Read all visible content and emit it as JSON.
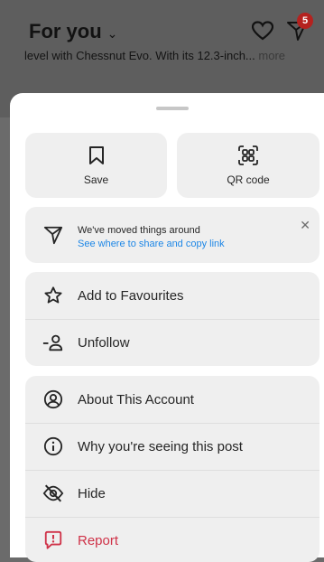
{
  "feed": {
    "title": "For you",
    "badge_count": "5",
    "caption_text": "level with Chessnut Evo. With its 12.3-inch...",
    "caption_more": "more"
  },
  "sheet": {
    "tiles": [
      {
        "label": "Save",
        "icon": "bookmark-icon"
      },
      {
        "label": "QR code",
        "icon": "qr-code-icon"
      }
    ],
    "notice": {
      "title": "We've moved things around",
      "link": "See where to share and copy link",
      "icon": "send-icon"
    },
    "group_a": [
      {
        "label": "Add to Favourites",
        "icon": "star-icon"
      },
      {
        "label": "Unfollow",
        "icon": "unfollow-icon"
      }
    ],
    "group_b": [
      {
        "label": "About This Account",
        "icon": "account-icon"
      },
      {
        "label": "Why you're seeing this post",
        "icon": "info-icon"
      },
      {
        "label": "Hide",
        "icon": "hide-icon"
      },
      {
        "label": "Report",
        "icon": "report-icon"
      }
    ]
  },
  "colors": {
    "link": "#1e87e6",
    "danger": "#cf3248",
    "badge": "#b5221f"
  }
}
